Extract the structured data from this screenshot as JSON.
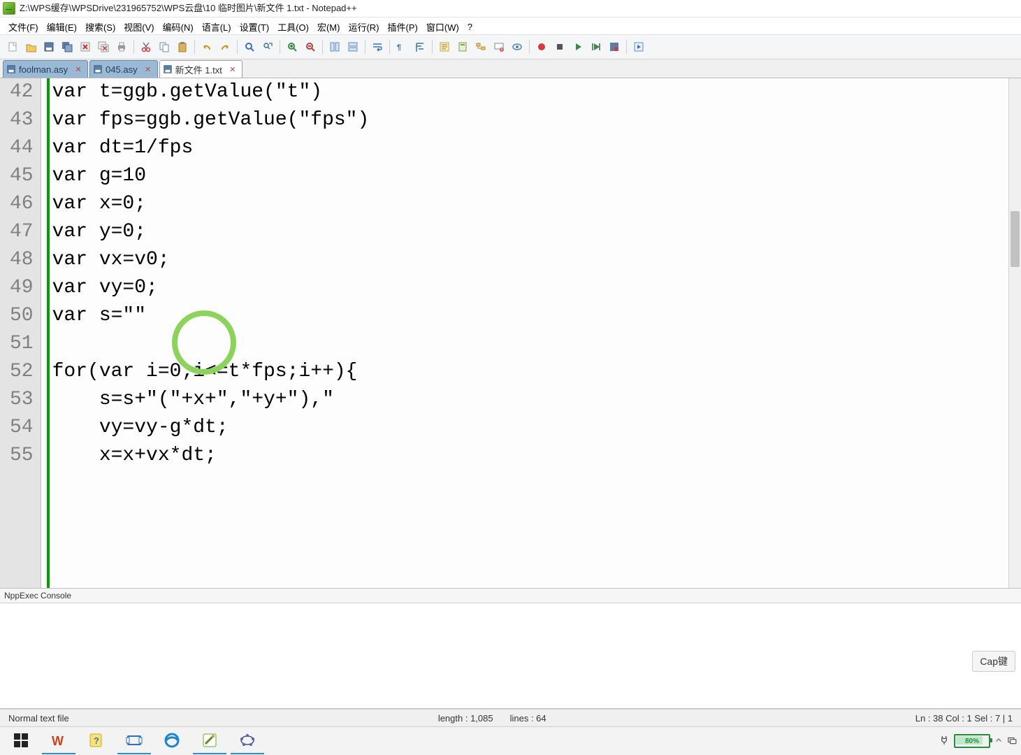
{
  "title": "Z:\\WPS缓存\\WPSDrive\\231965752\\WPS云盘\\10 临时图片\\新文件 1.txt - Notepad++",
  "menu": {
    "file": "文件(F)",
    "edit": "编辑(E)",
    "search": "搜索(S)",
    "view": "视图(V)",
    "encoding": "编码(N)",
    "language": "语言(L)",
    "settings": "设置(T)",
    "tools": "工具(O)",
    "macro": "宏(M)",
    "run": "运行(R)",
    "plugins": "插件(P)",
    "window": "窗口(W)",
    "help": "?"
  },
  "toolbar_icons": [
    "new-file",
    "open-file",
    "save",
    "save-all",
    "close",
    "close-all",
    "print",
    "|",
    "cut",
    "copy",
    "paste",
    "|",
    "undo",
    "redo",
    "|",
    "find",
    "replace",
    "|",
    "zoom-in",
    "zoom-out",
    "|",
    "sync-v",
    "sync-h",
    "|",
    "word-wrap",
    "|",
    "show-all",
    "indent-guide",
    "|",
    "func-list",
    "doc-map",
    "folder-tree",
    "monitor",
    "eye",
    "|",
    "record-macro",
    "stop-macro",
    "play-macro",
    "rec-list",
    "save-macro",
    "|",
    "nppexec-run"
  ],
  "tabs": [
    {
      "label": "foolman.asy",
      "active": false
    },
    {
      "label": "045.asy",
      "active": false
    },
    {
      "label": "新文件 1.txt",
      "active": true
    }
  ],
  "lines": [
    {
      "n": 42,
      "t": "var t=ggb.getValue(\"t\")"
    },
    {
      "n": 43,
      "t": "var fps=ggb.getValue(\"fps\")"
    },
    {
      "n": 44,
      "t": "var dt=1/fps"
    },
    {
      "n": 45,
      "t": "var g=10"
    },
    {
      "n": 46,
      "t": "var x=0;"
    },
    {
      "n": 47,
      "t": "var y=0;"
    },
    {
      "n": 48,
      "t": "var vx=v0;"
    },
    {
      "n": 49,
      "t": "var vy=0;"
    },
    {
      "n": 50,
      "t": "var s=\"\""
    },
    {
      "n": 51,
      "t": ""
    },
    {
      "n": 52,
      "t": "for(var i=0;i<=t*fps;i++){"
    },
    {
      "n": 53,
      "t": "    s=s+\"(\"+x+\",\"+y+\"),\""
    },
    {
      "n": 54,
      "t": "    vy=vy-g*dt;"
    },
    {
      "n": 55,
      "t": "    x=x+vx*dt;"
    }
  ],
  "console": {
    "title": "NppExec Console"
  },
  "cap_tip": "Cap键",
  "status": {
    "filetype": "Normal text file",
    "length": "length : 1,085",
    "lines": "lines : 64",
    "pos": "Ln : 38    Col : 1    Sel : 7 | 1"
  },
  "tray": {
    "battery": "80%"
  }
}
